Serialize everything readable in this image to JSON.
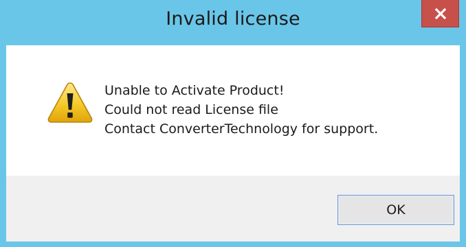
{
  "dialog": {
    "title": "Invalid license",
    "close_label": "x",
    "icon": "warning-icon",
    "message_lines": [
      "Unable to Activate Product!",
      "Could not read License file",
      "Contact ConverterTechnology for support."
    ],
    "ok_label": "OK"
  },
  "colors": {
    "titlebar": "#6ac6e8",
    "close_button": "#c7504a",
    "footer": "#f0f0f0",
    "ok_border": "#6c9ad8"
  }
}
